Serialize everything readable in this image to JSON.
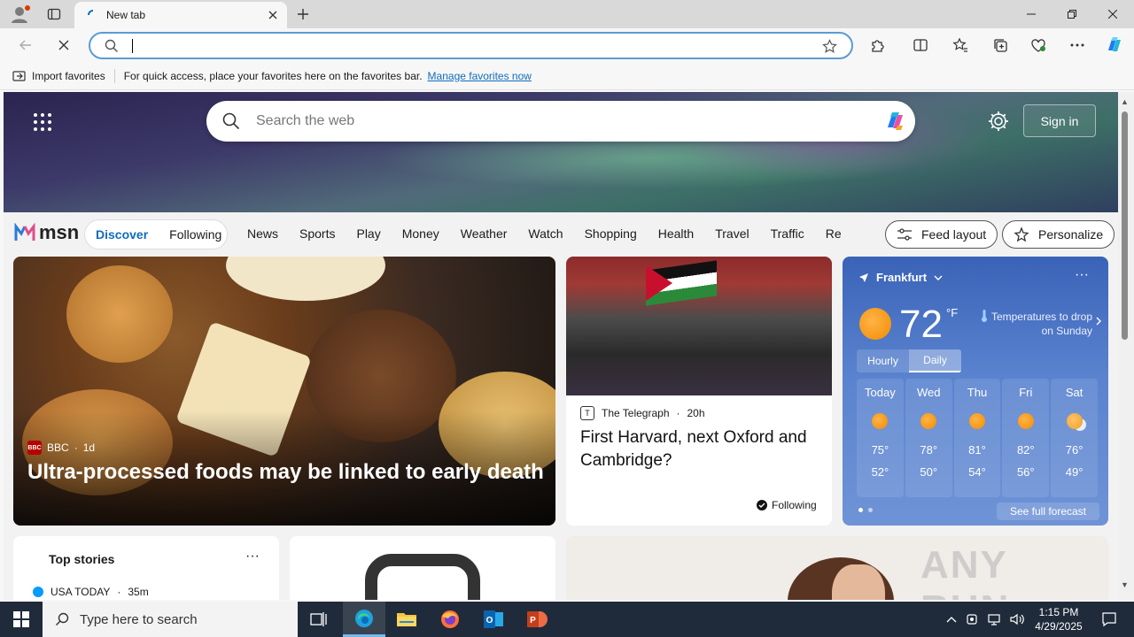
{
  "browser": {
    "tab_title": "New tab",
    "address_placeholder": "",
    "favorites_bar": {
      "import_label": "Import favorites",
      "hint_text": "For quick access, place your favorites here on the favorites bar.",
      "manage_link": "Manage favorites now"
    }
  },
  "msn": {
    "search_placeholder": "Search the web",
    "sign_in": "Sign in",
    "logo_text": "msn",
    "feed_tabs": [
      "Discover",
      "Following"
    ],
    "nav_links": [
      "News",
      "Sports",
      "Play",
      "Money",
      "Weather",
      "Watch",
      "Shopping",
      "Health",
      "Travel",
      "Traffic",
      "Real E"
    ],
    "feed_layout": "Feed layout",
    "personalize": "Personalize"
  },
  "main_story": {
    "source": "BBC",
    "age": "1d",
    "headline": "Ultra-processed foods may be linked to early death"
  },
  "secondary_story": {
    "source": "The Telegraph",
    "age": "20h",
    "headline": "First Harvard, next Oxford and Cambridge?",
    "following": "Following"
  },
  "weather": {
    "location": "Frankfurt",
    "temp": "72",
    "unit": "°F",
    "note": "Temperatures to drop on Sunday",
    "tabs": [
      "Hourly",
      "Daily"
    ],
    "forecast": [
      {
        "day": "Today",
        "hi": "75°",
        "lo": "52°",
        "icon": "sun-icon"
      },
      {
        "day": "Wed",
        "hi": "78°",
        "lo": "50°",
        "icon": "sun-icon"
      },
      {
        "day": "Thu",
        "hi": "81°",
        "lo": "54°",
        "icon": "sun-icon"
      },
      {
        "day": "Fri",
        "hi": "82°",
        "lo": "56°",
        "icon": "sun-icon"
      },
      {
        "day": "Sat",
        "hi": "76°",
        "lo": "49°",
        "icon": "partly-cloudy-icon"
      }
    ],
    "see_full": "See full forecast"
  },
  "top_stories": {
    "title": "Top stories",
    "source": "USA TODAY",
    "age": "35m"
  },
  "watermark": "ANY RUN",
  "taskbar": {
    "search_placeholder": "Type here to search",
    "time": "1:15 PM",
    "date": "4/29/2025"
  },
  "colors": {
    "accent": "#0f6cbd",
    "taskbar": "#1f2b3a",
    "weather_card": "#4a73c4"
  }
}
